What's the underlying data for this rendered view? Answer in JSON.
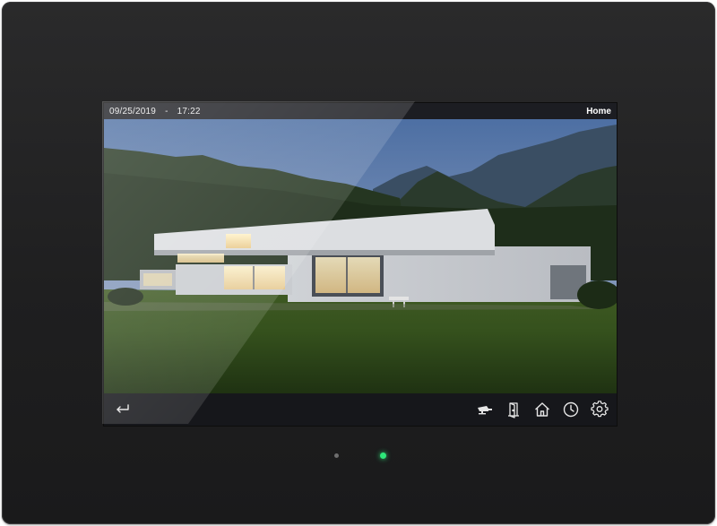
{
  "status_bar": {
    "date": "09/25/2019",
    "separator": "-",
    "time": "17:22",
    "page_title": "Home"
  },
  "background": {
    "description_icon": "villa-photo"
  },
  "nav_bar": {
    "back_icon": "back-arrow-icon",
    "right_icons": [
      "camera-icon",
      "door-icon",
      "home-icon",
      "clock-icon",
      "gear-icon"
    ]
  },
  "device": {
    "sensor_led_color": "#6e6e6e",
    "status_led_color": "#2ee87a"
  }
}
